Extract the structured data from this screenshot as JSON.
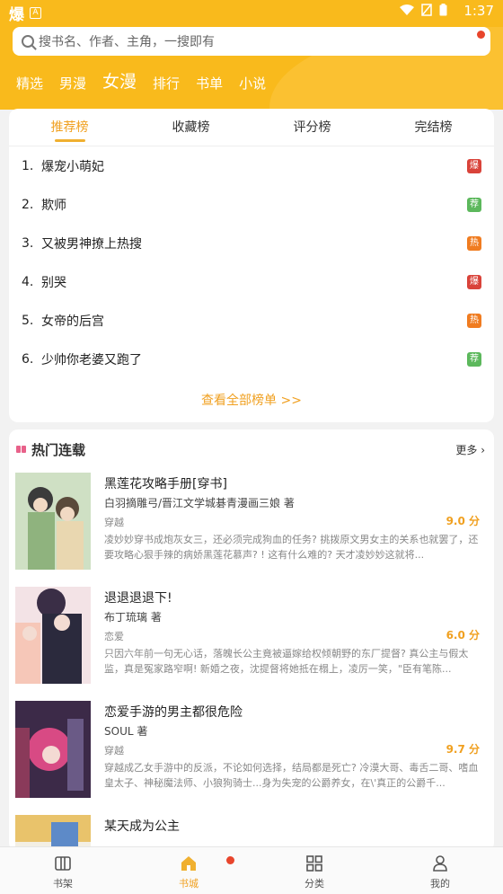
{
  "status_bar": {
    "app_glyph": "爆",
    "a_badge": "A",
    "time": "1:37"
  },
  "search": {
    "placeholder": "搜书名、作者、主角，一搜即有"
  },
  "nav_tabs": [
    "精选",
    "男漫",
    "女漫",
    "排行",
    "书单",
    "小说"
  ],
  "nav_active": "女漫",
  "ranking": {
    "tabs": [
      "推荐榜",
      "收藏榜",
      "评分榜",
      "完结榜"
    ],
    "active_tab": "推荐榜",
    "items": [
      {
        "num": "1.",
        "title": "爆宠小萌妃",
        "tag": "爆"
      },
      {
        "num": "2.",
        "title": "欺师",
        "tag": "荐"
      },
      {
        "num": "3.",
        "title": "又被男神撩上热搜",
        "tag": "热"
      },
      {
        "num": "4.",
        "title": "别哭",
        "tag": "爆"
      },
      {
        "num": "5.",
        "title": "女帝的后宫",
        "tag": "热"
      },
      {
        "num": "6.",
        "title": "少帅你老婆又跑了",
        "tag": "荐"
      }
    ],
    "view_all": "查看全部榜单 >>"
  },
  "hot_section": {
    "title": "热门连载",
    "more": "更多",
    "books": [
      {
        "title": "黑莲花攻略手册[穿书]",
        "author": "白羽摘雕弓/晋江文学城碁青漫画三娘 著",
        "genre": "穿越",
        "score": "9.0 分",
        "desc": "凌妙妙穿书成炮灰女三，还必须完成狗血的任务? 挑拨原文男女主的关系也就罢了，还要攻略心狠手辣的病娇黑莲花慕声? ! 这有什么难的? 天才凌妙妙这就将..."
      },
      {
        "title": "退退退退下!",
        "author": "布丁琉璃 著",
        "genre": "恋爱",
        "score": "6.0 分",
        "desc": "只因六年前一句无心话，落魄长公主竟被逼嫁给权倾朝野的东厂提督? 真公主与假太监，真是冤家路窄啊! 新婚之夜，沈提督将她抵在榻上，凌厉一笑，\"臣有笔陈..."
      },
      {
        "title": "恋爱手游的男主都很危险",
        "author": "SOUL 著",
        "genre": "穿越",
        "score": "9.7 分",
        "desc": "穿越成乙女手游中的反派，不论如何选择，结局都是死亡? 冷漠大哥、毒舌二哥、嗜血皇太子、神秘魔法师、小狼狗骑士...身为失宠的公爵养女，在\\'真正的公爵千..."
      },
      {
        "title": "某天成为公主",
        "author": "",
        "genre": "",
        "score": "",
        "desc": ""
      }
    ]
  },
  "bottom_nav": [
    "书架",
    "书城",
    "分类",
    "我的"
  ],
  "bottom_active": "书城",
  "colors": {
    "accent": "#f9ba1c",
    "active_text": "#f0a020",
    "tag_bao": "#d9433a",
    "tag_jian": "#5cb85c",
    "tag_re": "#f07c20",
    "dot": "#e8452c"
  },
  "icons": {
    "shelf": "bookshelf-icon",
    "store": "home-store-icon",
    "category": "grid-icon",
    "me": "person-icon",
    "search": "search-icon"
  }
}
